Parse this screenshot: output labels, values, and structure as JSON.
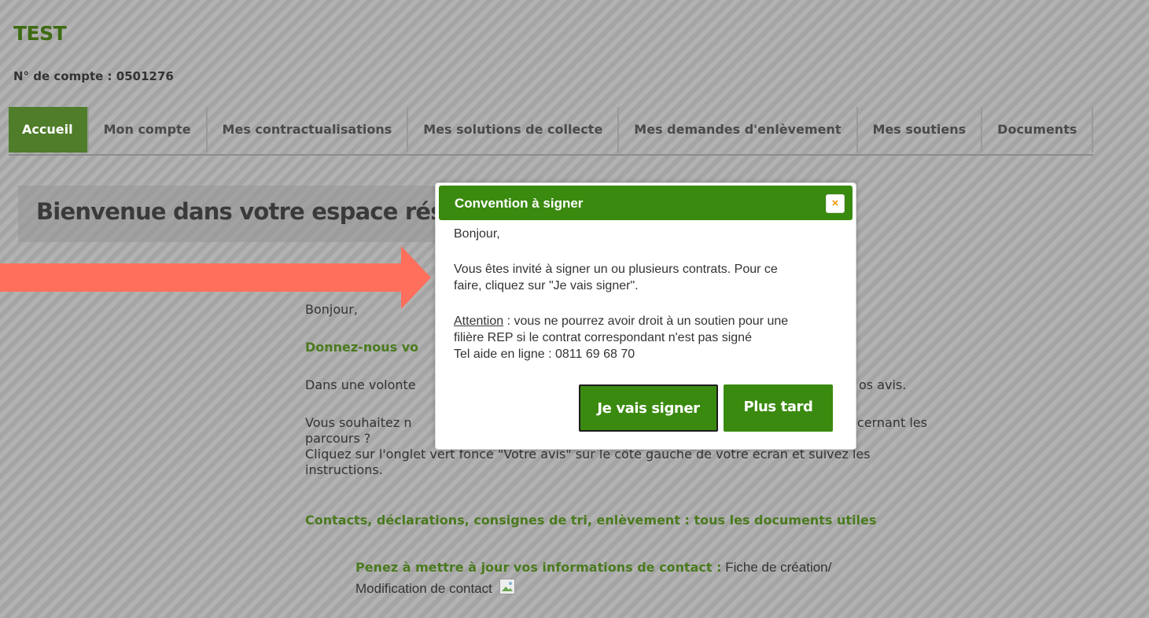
{
  "header": {
    "title": "TEST",
    "account_label": "N° de compte : ",
    "account_number": "0501276"
  },
  "nav": {
    "tabs": [
      {
        "label": "Accueil",
        "active": true
      },
      {
        "label": "Mon compte"
      },
      {
        "label": "Mes contractualisations"
      },
      {
        "label": "Mes solutions de collecte"
      },
      {
        "label": "Mes demandes d'enlèvement"
      },
      {
        "label": "Mes soutiens"
      },
      {
        "label": "Documents"
      }
    ]
  },
  "main": {
    "welcome": "Bienvenue dans votre espace réservé",
    "greeting": "Bonjour,",
    "feedback_title": "Donnez-nous vo",
    "intro_left": "Dans une volonte",
    "intro_right": "os avis.",
    "question_left": "Vous souhaitez n",
    "question_right": "oncernant les",
    "question_line2": "parcours ?",
    "instructions_line1": "Cliquez sur l'onglet vert foncé \"Votre avis\" sur le côté gauche de votre écran et suivez les",
    "instructions_line2": "instructions.",
    "documents_title": "Contacts, déclarations, consignes de tri, enlèvement : tous les documents utiles",
    "contact_label": "Penez à mettre à jour vos informations de contact :",
    "contact_link_1": " Fiche de création/",
    "contact_link_2": "Modification de contact"
  },
  "modal": {
    "title": "Convention à signer",
    "close": "×",
    "greeting": "Bonjour,",
    "line1": "Vous êtes invité à signer un ou plusieurs contrats. Pour ce",
    "line2": "faire, cliquez sur \"Je vais signer\".",
    "attention_label": "Attention",
    "attention_text": " : vous ne pourrez avoir droit à un soutien pour une",
    "line4": "filière REP si le contrat correspondant n'est pas signé",
    "line5": "Tel aide en ligne : 0811 69 68 70",
    "sign_button": "Je vais signer",
    "later_button": "Plus tard"
  },
  "colors": {
    "brand_green": "#3a8a10",
    "nav_active": "#4f7d2a",
    "arrow": "#ff6f5b",
    "close_icon": "#f39c12"
  }
}
